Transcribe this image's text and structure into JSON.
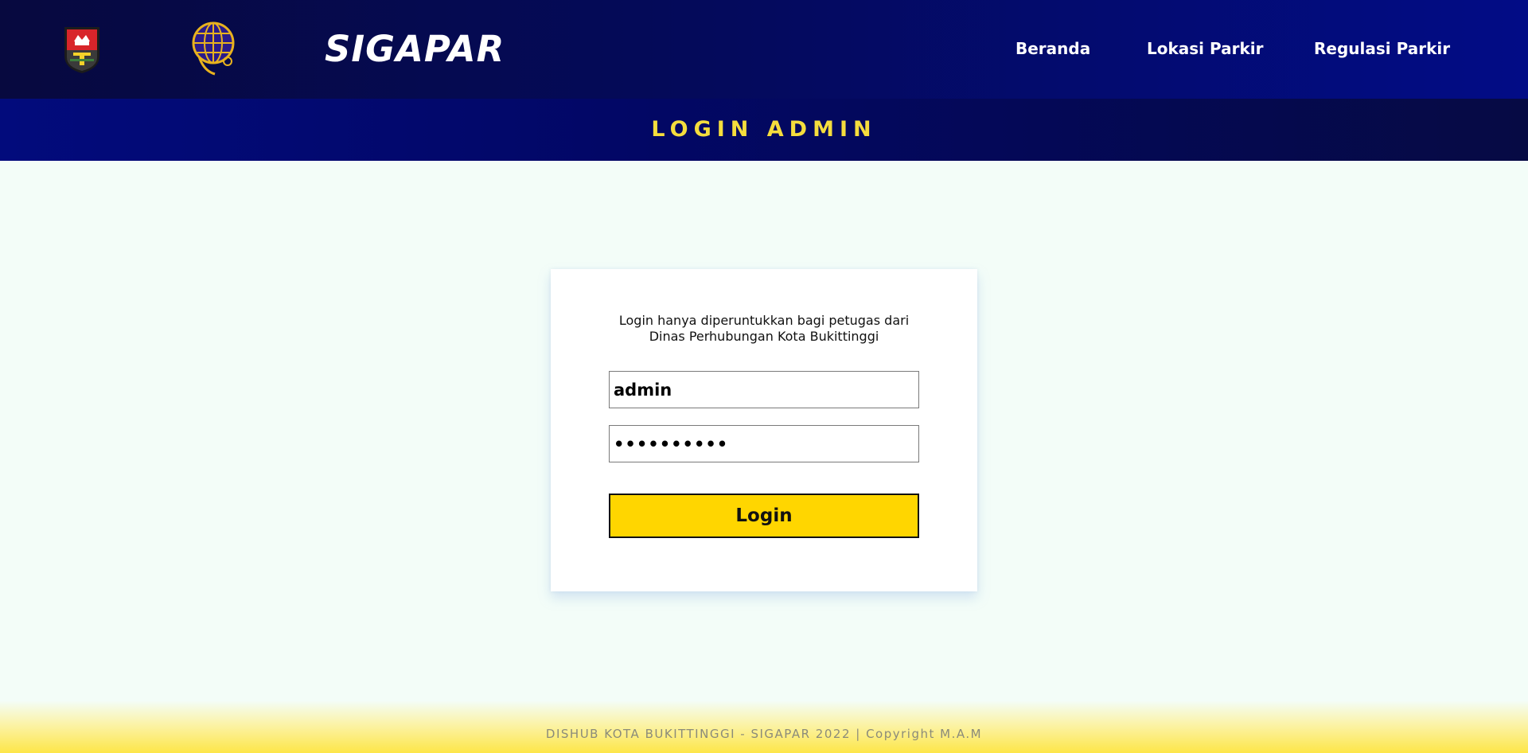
{
  "header": {
    "brand": "SIGAPAR",
    "logos": [
      "crest-icon",
      "dishub-globe-icon"
    ],
    "nav": [
      {
        "label": "Beranda"
      },
      {
        "label": "Lokasi Parkir"
      },
      {
        "label": "Regulasi Parkir"
      }
    ]
  },
  "title_band": {
    "title": "LOGIN ADMIN"
  },
  "login": {
    "notice_line1": "Login hanya diperuntukkan bagi petugas dari",
    "notice_line2": "Dinas Perhubungan Kota Bukittinggi",
    "username_value": "admin",
    "password_value": "••••••••••",
    "button_label": "Login"
  },
  "footer": {
    "copyright": "DISHUB KOTA BUKITTINGGI - SIGAPAR 2022 | Copyright M.A.M"
  },
  "colors": {
    "header_bg": "#040a5a",
    "accent_yellow": "#ffd600",
    "title_text": "#f5dd3d",
    "page_bg": "#f3fdf8"
  }
}
